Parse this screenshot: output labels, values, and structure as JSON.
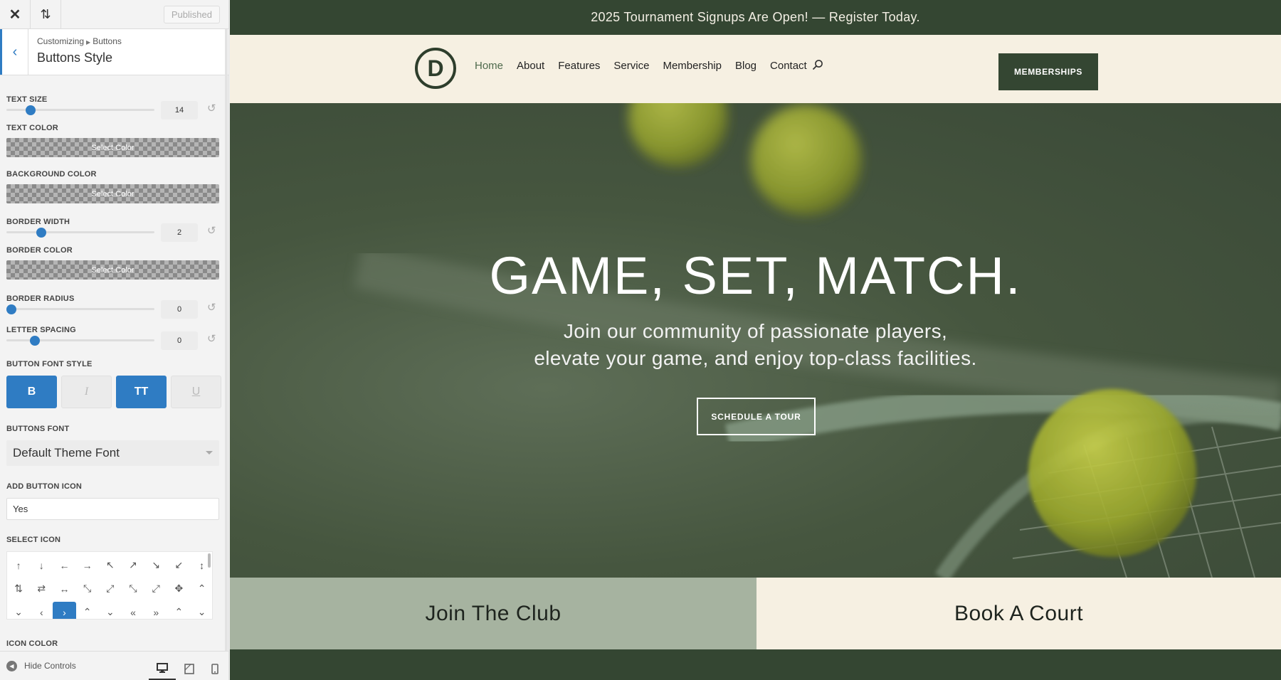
{
  "sidebar": {
    "published_label": "Published",
    "breadcrumb": [
      "Customizing",
      "Buttons"
    ],
    "title": "Buttons Style",
    "text_size": {
      "label": "Text Size",
      "value": "14",
      "level": 0.13
    },
    "text_color": {
      "label": "Text Color",
      "placeholder": "Select Color"
    },
    "background_color": {
      "label": "Background Color",
      "placeholder": "Select Color"
    },
    "border_width": {
      "label": "Border Width",
      "value": "2",
      "level": 0.2
    },
    "border_color": {
      "label": "Border Color",
      "placeholder": "Select Color"
    },
    "border_radius": {
      "label": "Border Radius",
      "value": "0",
      "level": 0.0
    },
    "letter_spacing": {
      "label": "Letter Spacing",
      "value": "0",
      "level": 0.16
    },
    "font_style": {
      "label": "Button Font Style",
      "bold": "B",
      "italic": "I",
      "uppercase": "TT",
      "underline": "U"
    },
    "buttons_font": {
      "label": "Buttons Font",
      "value": "Default Theme Font"
    },
    "add_icon": {
      "label": "Add Button Icon",
      "value": "Yes"
    },
    "select_icon": {
      "label": "Select Icon",
      "icons": [
        "↑",
        "↓",
        "←",
        "→",
        "↖",
        "↗",
        "↘",
        "↙",
        "↕",
        "⇅",
        "⇄",
        "↔",
        "⤡",
        "⤢",
        "⤡",
        "⤢",
        "✥",
        "⌃",
        "⌄",
        "‹",
        "›",
        "⌃",
        "⌄",
        "«",
        "»",
        "⌃",
        "⌄"
      ],
      "selected_index": 20
    },
    "icon_color_label": "Icon Color",
    "hide_controls": "Hide Controls"
  },
  "preview": {
    "announcement": "2025 Tournament Signups Are Open! — Register Today.",
    "logo_letter": "D",
    "nav": [
      "Home",
      "About",
      "Features",
      "Service",
      "Membership",
      "Blog",
      "Contact"
    ],
    "memberships_button": "MEMBERSHIPS",
    "hero_title": "GAME, SET, MATCH.",
    "hero_sub_line1": "Join our community of passionate players,",
    "hero_sub_line2": "elevate your game, and enjoy top-class facilities.",
    "tour_button": "SCHEDULE A TOUR",
    "cta_left": "Join The Club",
    "cta_right": "Book A Court"
  },
  "colors": {
    "accent_blue": "#2f7cc3",
    "dark_green": "#344632",
    "cream": "#f6f0e2",
    "sage": "#a6b3a0"
  }
}
